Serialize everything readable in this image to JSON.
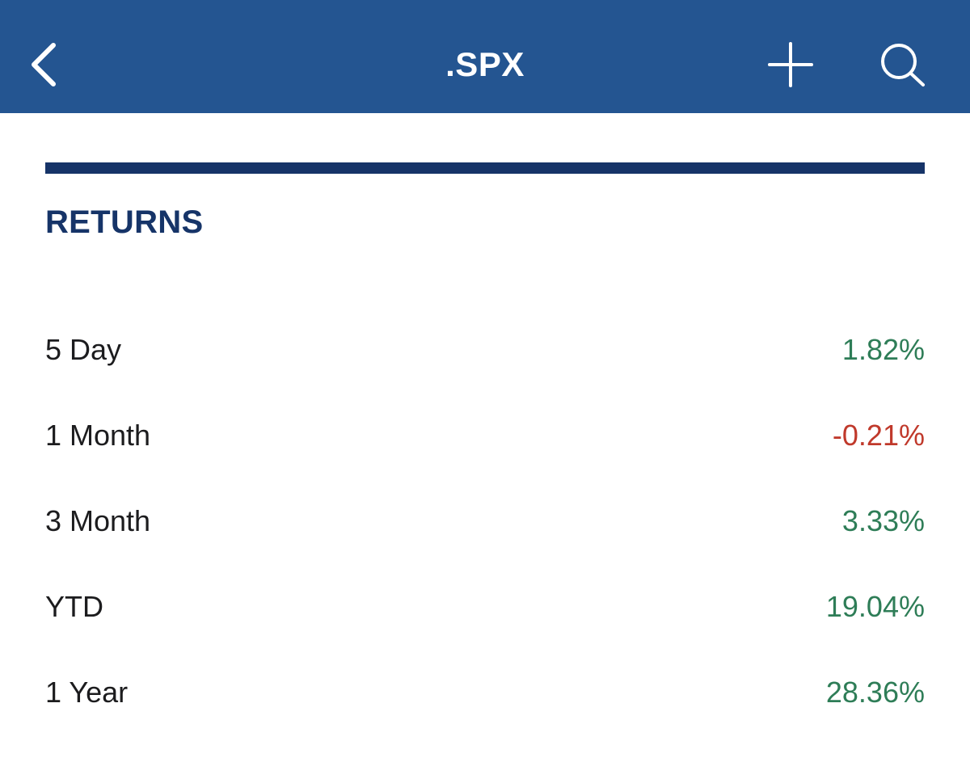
{
  "header": {
    "title": ".SPX",
    "back_icon": "chevron-left-icon",
    "add_icon": "plus-icon",
    "search_icon": "search-icon"
  },
  "section": {
    "title": "RETURNS"
  },
  "colors": {
    "header_bg": "#245591",
    "accent_dark": "#163468",
    "positive": "#2e7d57",
    "negative": "#c0392b"
  },
  "returns": [
    {
      "label": "5 Day",
      "value": "1.82%",
      "trend": "positive"
    },
    {
      "label": "1 Month",
      "value": "-0.21%",
      "trend": "negative"
    },
    {
      "label": "3 Month",
      "value": "3.33%",
      "trend": "positive"
    },
    {
      "label": "YTD",
      "value": "19.04%",
      "trend": "positive"
    },
    {
      "label": "1 Year",
      "value": "28.36%",
      "trend": "positive"
    }
  ]
}
